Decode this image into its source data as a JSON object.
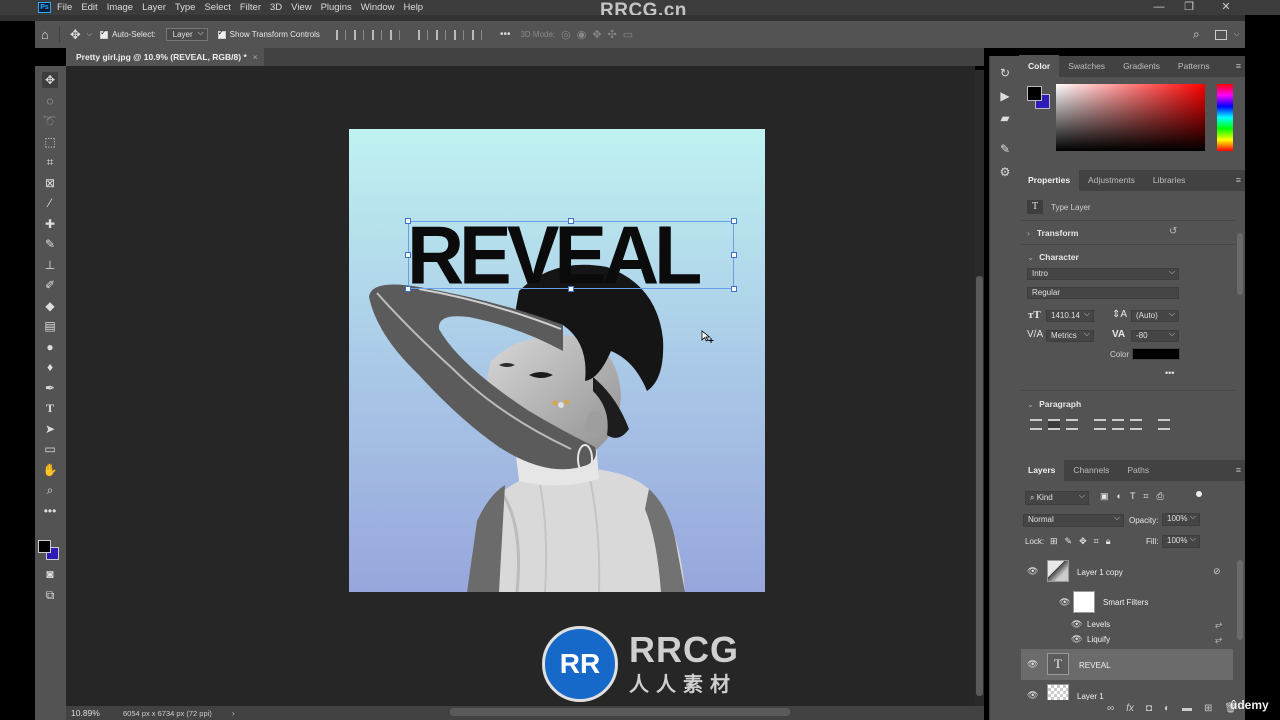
{
  "app": {
    "logo": "Ps",
    "watermark_top": "RRCG.cn"
  },
  "menu": [
    "File",
    "Edit",
    "Image",
    "Layer",
    "Type",
    "Select",
    "Filter",
    "3D",
    "View",
    "Plugins",
    "Window",
    "Help"
  ],
  "window_controls": {
    "minimize": "—",
    "restore": "❐",
    "close": "✕"
  },
  "options_bar": {
    "auto_select_label": "Auto-Select:",
    "auto_select_value": "Layer",
    "show_transform_label": "Show Transform Controls",
    "more": "•••",
    "mode_3d": "3D Mode:"
  },
  "document": {
    "tab_title": "Pretty girl.jpg @ 10.9% (REVEAL, RGB/8) *",
    "tab_close": "×",
    "zoom": "10.89%",
    "info": "6054 px x 6734 px (72 ppi)",
    "status_arrow": "›"
  },
  "artwork": {
    "headline": "REVEAL"
  },
  "watermark": {
    "badge": "RR",
    "brand": "RRCG",
    "sub": "人人素材"
  },
  "colors": {
    "foreground": "#000000",
    "background": "#2d1cb8",
    "sky_top": "#bdf0f0",
    "sky_bottom": "#98a8dc"
  },
  "color_panel": {
    "tabs": [
      "Color",
      "Swatches",
      "Gradients",
      "Patterns"
    ]
  },
  "properties_panel": {
    "tabs": [
      "Properties",
      "Adjustments",
      "Libraries"
    ],
    "layer_type": "Type Layer",
    "transform_label": "Transform",
    "character_label": "Character",
    "font_family": "Intro",
    "font_style": "Regular",
    "font_size": "1410.14",
    "leading": "(Auto)",
    "kerning": "Metrics",
    "tracking": "-80",
    "color_label": "Color",
    "more": "•••",
    "paragraph_label": "Paragraph"
  },
  "layers_panel": {
    "tabs": [
      "Layers",
      "Channels",
      "Paths"
    ],
    "filter_kind": "Kind",
    "blend_mode": "Normal",
    "opacity_label": "Opacity:",
    "opacity_value": "100%",
    "lock_label": "Lock:",
    "fill_label": "Fill:",
    "fill_value": "100%",
    "layers": [
      {
        "name": "Layer 1 copy"
      },
      {
        "name": "Smart Filters"
      },
      {
        "name": "Levels"
      },
      {
        "name": "Liquify"
      },
      {
        "name": "REVEAL"
      },
      {
        "name": "Layer 1"
      }
    ]
  },
  "udemy": "ûdemy"
}
